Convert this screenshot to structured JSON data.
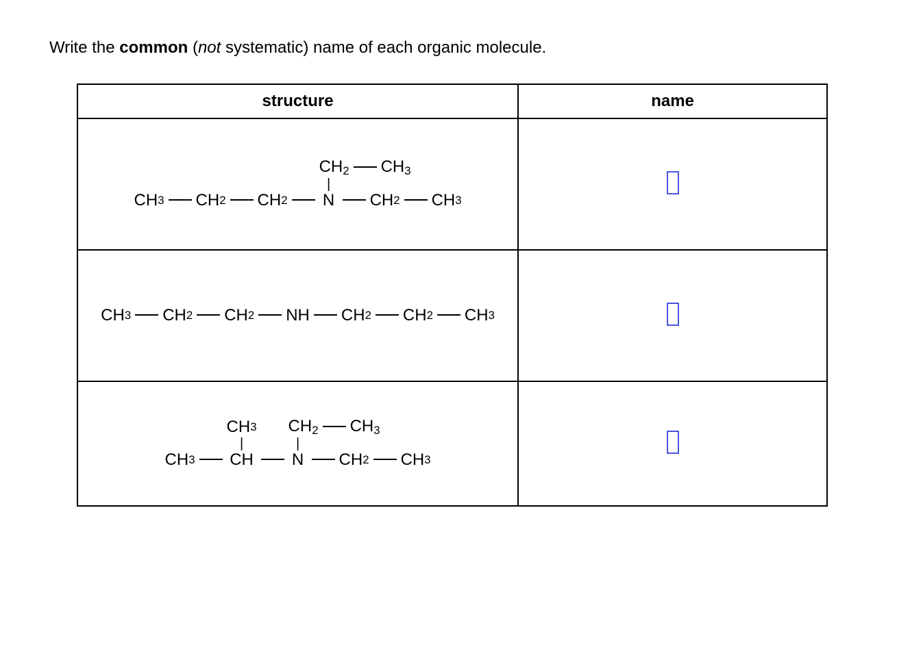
{
  "prompt": {
    "pre": "Write the ",
    "bold": "common",
    "open_paren": " (",
    "italic": "not",
    "post": " systematic) name of each organic molecule."
  },
  "table": {
    "head_structure": "structure",
    "head_name": "name"
  },
  "chem": {
    "CH3": "CH",
    "CH3_sub": "3",
    "CH2": "CH",
    "CH2_sub": "2",
    "CH": "CH",
    "N": "N",
    "NH": "NH",
    "vbar": "|"
  },
  "answers": {
    "row1": "",
    "row2": "",
    "row3": ""
  }
}
